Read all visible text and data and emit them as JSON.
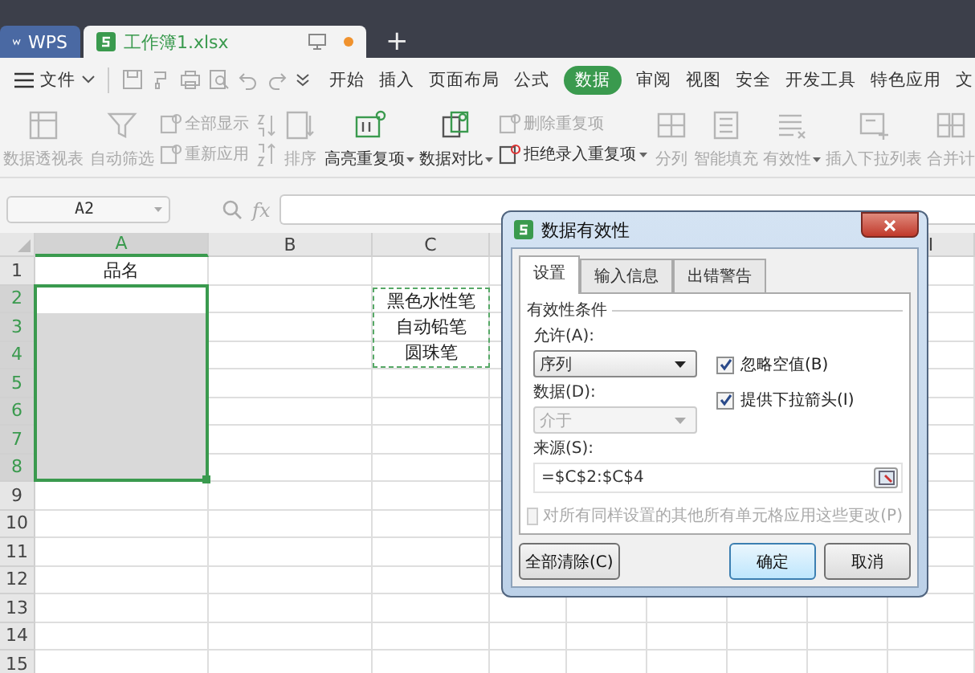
{
  "app_tabs": [
    {
      "kind": "home",
      "label": "WPS",
      "selected": false
    },
    {
      "kind": "document",
      "label": "工作簿1.xlsx",
      "selected": true,
      "unsaved": true
    }
  ],
  "new_tab": "+",
  "menu": {
    "file": "文件",
    "tabs": [
      {
        "label": "开始",
        "selected": false
      },
      {
        "label": "插入",
        "selected": false
      },
      {
        "label": "页面布局",
        "selected": false
      },
      {
        "label": "公式",
        "selected": false
      },
      {
        "label": "数据",
        "selected": true
      },
      {
        "label": "审阅",
        "selected": false
      },
      {
        "label": "视图",
        "selected": false
      },
      {
        "label": "安全",
        "selected": false
      },
      {
        "label": "开发工具",
        "selected": false
      },
      {
        "label": "特色应用",
        "selected": false
      },
      {
        "label": "文",
        "selected": false
      }
    ]
  },
  "ribbon": [
    {
      "items": [
        {
          "kind": "large",
          "label": "数据透视表",
          "disabled": true,
          "dropdown": false
        }
      ]
    },
    {
      "items": [
        {
          "kind": "large",
          "label": "自动筛选",
          "disabled": true,
          "dropdown": false
        },
        {
          "kind": "stack",
          "children": [
            {
              "label": "全部显示",
              "disabled": true,
              "dropdown": false
            },
            {
              "label": "重新应用",
              "disabled": true,
              "dropdown": false
            }
          ]
        }
      ]
    },
    {
      "items": [
        {
          "kind": "sort_buttons",
          "disabled": true
        },
        {
          "kind": "large",
          "label": "排序",
          "disabled": true,
          "dropdown": false
        }
      ]
    },
    {
      "items": [
        {
          "kind": "large",
          "label": "高亮重复项",
          "disabled": false,
          "dropdown": true
        },
        {
          "kind": "large",
          "label": "数据对比",
          "disabled": false,
          "dropdown": true
        },
        {
          "kind": "stack",
          "children": [
            {
              "label": "删除重复项",
              "disabled": true,
              "dropdown": false
            },
            {
              "label": "拒绝录入重复项",
              "disabled": false,
              "dropdown": true
            }
          ]
        }
      ]
    },
    {
      "items": [
        {
          "kind": "large",
          "label": "分列",
          "disabled": true,
          "dropdown": false
        },
        {
          "kind": "large",
          "label": "智能填充",
          "disabled": true,
          "dropdown": false
        },
        {
          "kind": "large",
          "label": "有效性",
          "disabled": true,
          "dropdown": true
        },
        {
          "kind": "large",
          "label": "插入下拉列表",
          "disabled": true,
          "dropdown": false
        },
        {
          "kind": "large",
          "label": "合并计",
          "disabled": true,
          "dropdown": false
        }
      ]
    }
  ],
  "formula_bar": {
    "name_box": "A2",
    "function_label": "fx"
  },
  "sheet": {
    "columns": [
      {
        "label": "A",
        "selected": true
      },
      {
        "label": "B",
        "selected": false
      },
      {
        "label": "C",
        "selected": false
      },
      {
        "label": "I",
        "selected": false
      }
    ],
    "rows": [
      {
        "label": "1",
        "selected": false
      },
      {
        "label": "2",
        "selected": true
      },
      {
        "label": "3",
        "selected": true
      },
      {
        "label": "4",
        "selected": true
      },
      {
        "label": "5",
        "selected": true
      },
      {
        "label": "6",
        "selected": true
      },
      {
        "label": "7",
        "selected": true
      },
      {
        "label": "8",
        "selected": true
      },
      {
        "label": "9",
        "selected": false
      },
      {
        "label": "10",
        "selected": false
      },
      {
        "label": "11",
        "selected": false
      },
      {
        "label": "12",
        "selected": false
      },
      {
        "label": "13",
        "selected": false
      },
      {
        "label": "14",
        "selected": false
      },
      {
        "label": "15",
        "selected": false
      }
    ],
    "column_a_header": "品名",
    "copied_range": [
      "黑色水性笔",
      "自动铅笔",
      "圆珠笔"
    ]
  },
  "dialog": {
    "title": "数据有效性",
    "tabs": [
      {
        "label": "设置",
        "selected": true
      },
      {
        "label": "输入信息",
        "selected": false
      },
      {
        "label": "出错警告",
        "selected": false
      }
    ],
    "group_label": "有效性条件",
    "allow": {
      "label": "允许(A):",
      "value": "序列",
      "disabled": false
    },
    "data": {
      "label": "数据(D):",
      "value": "介于",
      "disabled": true
    },
    "options": [
      {
        "label": "忽略空值(B)",
        "checked": true,
        "disabled": false
      },
      {
        "label": "提供下拉箭头(I)",
        "checked": true,
        "disabled": false
      }
    ],
    "source": {
      "label": "来源(S):",
      "value": "=$C$2:$C$4"
    },
    "apply_all": {
      "label": "对所有同样设置的其他所有单元格应用这些更改(P)",
      "checked": false,
      "disabled": true
    },
    "clear_button": "全部清除(C)",
    "buttons": [
      {
        "label": "确定",
        "default": true
      },
      {
        "label": "取消",
        "default": false
      }
    ]
  }
}
